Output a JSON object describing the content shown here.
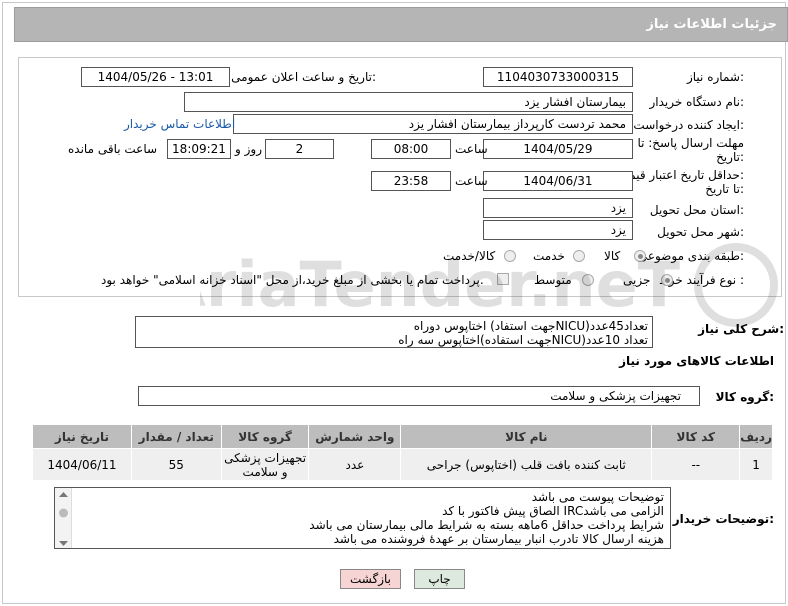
{
  "header": {
    "title": "جزئیات اطلاعات نیاز"
  },
  "fields": {
    "need_number_label": "شماره نیاز:",
    "need_number": "1104030733000315",
    "announce_label": "تاریخ و ساعت اعلان عمومی:",
    "announce_value": "1404/05/26 - 13:01",
    "buyer_org_label": "نام دستگاه خریدار:",
    "buyer_org": "بیمارستان افشار یزد",
    "requester_label": "ایجاد کننده درخواست:",
    "requester": "محمد تردست کارپرداز بیمارستان افشار یزد",
    "buyer_contact_link": "اطلاعات تماس خریدار",
    "deadline_label_1": "مهلت ارسال پاسخ: تا",
    "deadline_label_2": "تاریخ:",
    "deadline_date": "1404/05/29",
    "time_label": "ساعت",
    "deadline_time": "08:00",
    "days_value": "2",
    "days_label": "روز و",
    "remaining_time": "18:09:21",
    "remaining_label": "ساعت باقی مانده",
    "price_validity_label_1": "حداقل تاریخ اعتبار قیمت:",
    "price_validity_label_2": "تا تاریخ:",
    "price_validity_date": "1404/06/31",
    "price_validity_time": "23:58",
    "province_label": "استان محل تحویل:",
    "province": "یزد",
    "city_label": "شهر محل تحویل:",
    "city": "یزد",
    "category_label": "طبقه بندی موضوعی:",
    "category_options": [
      "کالا",
      "خدمت",
      "کالا/خدمت"
    ],
    "process_label": "نوع فرآیند خرید :",
    "process_options": [
      "جزیی",
      "متوسط"
    ],
    "payment_note": "پرداخت تمام یا بخشی از مبلغ خرید،از محل \"اسناد خزانه اسلامی\" خواهد بود."
  },
  "description": {
    "label": "شرح کلی نیاز:",
    "lines": [
      "اختاپوس دوراه (جهت استفادNICU)تعداد45عدد",
      "اختاپوس سه راه(جهت استفادهNICU)تعداد 10عدد"
    ]
  },
  "goods_section": {
    "title": "اطلاعات کالاهای مورد نیاز",
    "group_label": "گروه کالا:",
    "group_value": "تجهیزات پزشکی و سلامت"
  },
  "table": {
    "columns": [
      "ردیف",
      "کد کالا",
      "نام کالا",
      "واحد شمارش",
      "گروه کالا",
      "تعداد / مقدار",
      "تاریخ نیاز"
    ],
    "rows": [
      [
        "1",
        "--",
        "ثابت کننده بافت قلب (اختاپوس) جراحی",
        "عدد",
        "تجهیزات پزشکی و سلامت",
        "55",
        "1404/06/11"
      ]
    ]
  },
  "buyer_notes": {
    "label": "توضیحات خریدار:",
    "lines": [
      "توضیحات پیوست می باشد",
      "الصاق پیش فاکتور با کد  IRCالزامی می باشد",
      "شرایط پرداخت حداقل 6ماهه بسته به شرایط مالی بیمارستان می باشد",
      "هزینه ارسال کالا تادرب انبار بیمارستان بر عهدۀ فروشنده می باشد"
    ]
  },
  "buttons": {
    "print": "چاپ",
    "back": "بازگشت"
  },
  "colors": {
    "title_bar": "#b5b5b5",
    "link": "#1a5aa6",
    "back_btn": "#f7d4d4",
    "print_btn": "#dde9dd"
  }
}
